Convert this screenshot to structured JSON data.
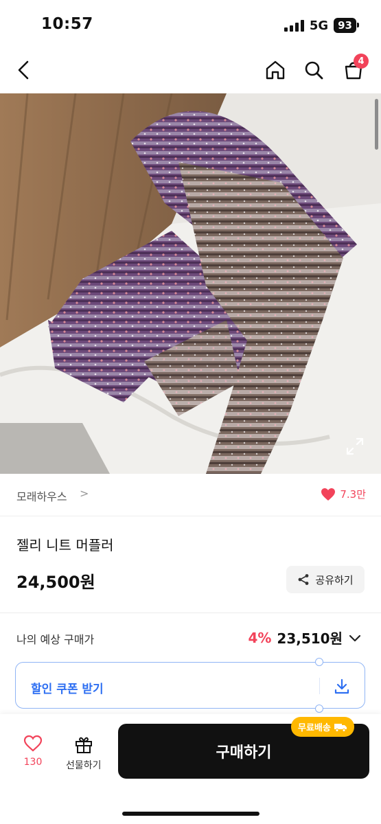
{
  "status": {
    "time": "10:57",
    "network": "5G",
    "battery": "93"
  },
  "nav": {
    "cart_count": "4"
  },
  "seller": {
    "name": "모래하우스",
    "chevron": ">",
    "like_count": "7.3만"
  },
  "product": {
    "title": "젤리 니트 머플러",
    "price": "24,500원",
    "share_label": "공유하기"
  },
  "expected": {
    "label": "나의 예상 구매가",
    "discount": "4%",
    "price": "23,510원"
  },
  "coupon": {
    "label": "할인 쿠폰 받기"
  },
  "bottom": {
    "like_count": "130",
    "gift_label": "선물하기",
    "buy_label": "구매하기",
    "free_shipping": "무료배송"
  },
  "colors": {
    "accent": "#f2435a",
    "coupon_blue": "#2e6ff2",
    "badge_yellow": "#ffb800",
    "button_dark": "#111111"
  }
}
